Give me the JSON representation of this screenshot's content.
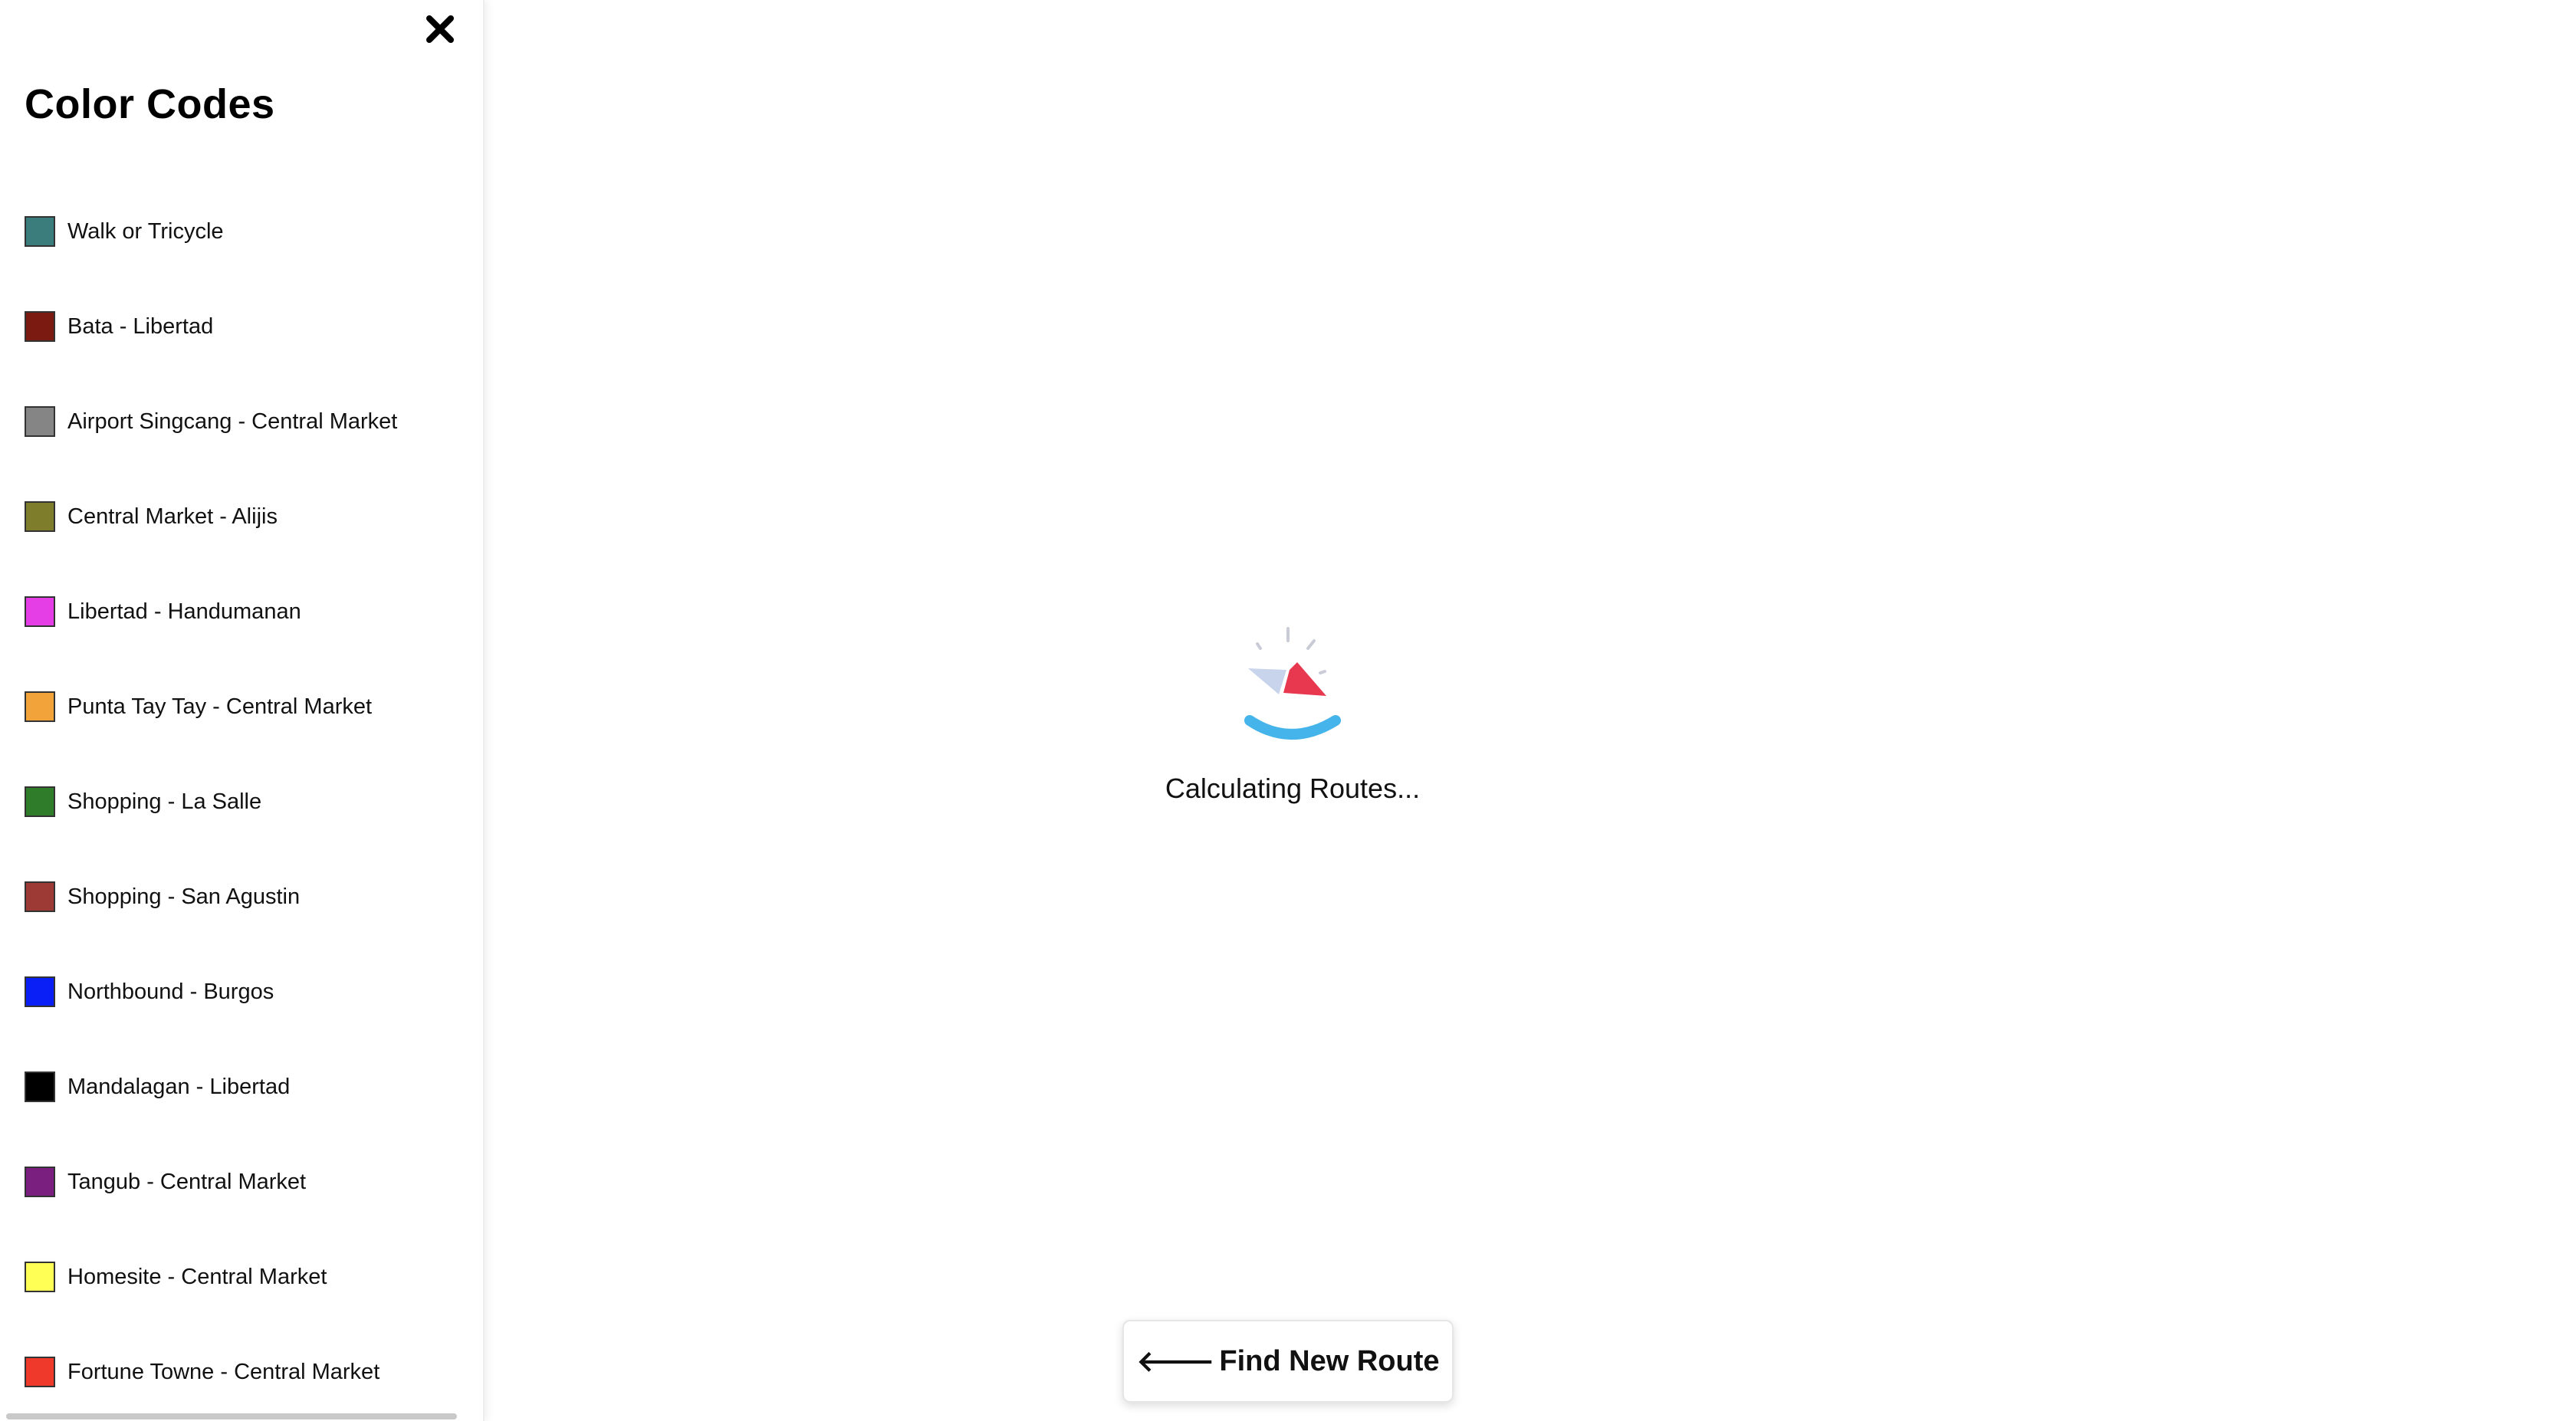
{
  "sidebar": {
    "title": "Color Codes",
    "close_icon": "close-icon",
    "legend": [
      {
        "label": "Walk or Tricycle",
        "color": "#3a7d7c"
      },
      {
        "label": "Bata - Libertad",
        "color": "#7a1a10"
      },
      {
        "label": "Airport Singcang - Central Market",
        "color": "#858585"
      },
      {
        "label": "Central Market - Alijis",
        "color": "#7d7d2b"
      },
      {
        "label": "Libertad - Handumanan",
        "color": "#e63ee6"
      },
      {
        "label": "Punta Tay Tay - Central Market",
        "color": "#f2a33a"
      },
      {
        "label": "Shopping - La Salle",
        "color": "#2f7d2a"
      },
      {
        "label": "Shopping - San Agustin",
        "color": "#9e3a35"
      },
      {
        "label": "Northbound - Burgos",
        "color": "#0a1ff5"
      },
      {
        "label": "Mandalagan - Libertad",
        "color": "#000000"
      },
      {
        "label": "Tangub - Central Market",
        "color": "#7a1f80"
      },
      {
        "label": "Homesite - Central Market",
        "color": "#ffff55"
      },
      {
        "label": "Fortune Towne - Central Market",
        "color": "#ef3a2b"
      }
    ]
  },
  "main": {
    "loading_icon": "compass-loading-icon",
    "loading_text": "Calculating Routes...",
    "find_button": {
      "arrow_icon": "arrow-left-icon",
      "label": "Find New Route"
    }
  }
}
